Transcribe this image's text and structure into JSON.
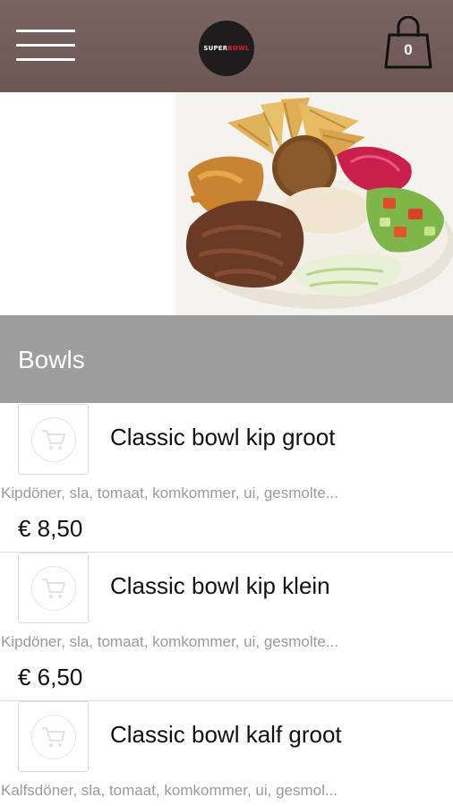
{
  "header": {
    "menu_icon": "hamburger-menu-icon",
    "logo_text_a": "SUPER",
    "logo_text_b": "BOWL",
    "cart_count": "0",
    "cart_icon": "shopping-bag-icon"
  },
  "hero": {
    "image": "food-bowl-photo"
  },
  "category": {
    "title": "Bowls"
  },
  "items": [
    {
      "name": "Classic bowl kip groot",
      "description": "Kipdöner, sla, tomaat, komkommer, ui, gesmolte...",
      "price": "€ 8,50",
      "icon": "add-to-cart-icon"
    },
    {
      "name": "Classic bowl kip klein",
      "description": "Kipdöner, sla, tomaat, komkommer, ui, gesmolte...",
      "price": "€ 6,50",
      "icon": "add-to-cart-icon"
    },
    {
      "name": "Classic bowl kalf groot",
      "description": "Kalfsdöner, sla, tomaat, komkommer, ui, gesmol...",
      "price": "",
      "icon": "add-to-cart-icon"
    }
  ],
  "colors": {
    "header_bg": "#6d5754",
    "category_bg": "#9e9e9e",
    "logo_accent": "#d4262e"
  }
}
